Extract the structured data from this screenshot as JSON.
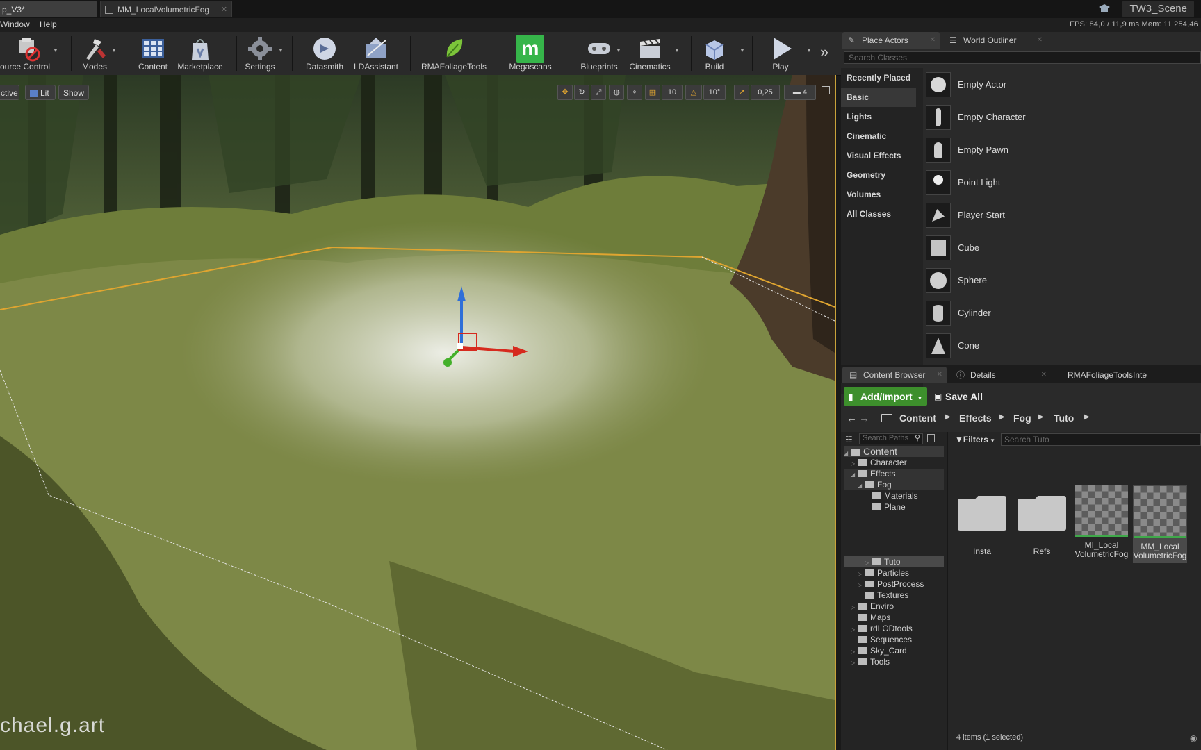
{
  "tabs": [
    {
      "label": "p_V3*",
      "active": true
    },
    {
      "label": "MM_LocalVolumetricFog",
      "active": false
    }
  ],
  "scene_name": "TW3_Scene",
  "menu": [
    "Window",
    "Help"
  ],
  "stats": "FPS: 84,0   / 11,9 ms   Mem: 11 254,46",
  "toolbar": [
    {
      "label": "ource Control",
      "icon": "source-control-icon"
    },
    {
      "label": "Modes",
      "icon": "modes-icon"
    },
    {
      "label": "Content",
      "icon": "content-icon"
    },
    {
      "label": "Marketplace",
      "icon": "marketplace-icon"
    },
    {
      "label": "Settings",
      "icon": "settings-icon"
    },
    {
      "label": "Datasmith",
      "icon": "datasmith-icon"
    },
    {
      "label": "LDAssistant",
      "icon": "ldassistant-icon"
    },
    {
      "label": "RMAFoliageTools",
      "icon": "leaf-icon"
    },
    {
      "label": "Megascans",
      "icon": "megascans-icon"
    },
    {
      "label": "Blueprints",
      "icon": "blueprints-icon"
    },
    {
      "label": "Cinematics",
      "icon": "clapper-icon"
    },
    {
      "label": "Build",
      "icon": "build-icon"
    },
    {
      "label": "Play",
      "icon": "play-icon"
    }
  ],
  "viewport": {
    "mode_left": "ctive",
    "lit": "Lit",
    "show": "Show",
    "grid_snap": "10",
    "rot_snap": "10°",
    "scale_snap": "0,25",
    "cam_speed": "4",
    "watermark": "chael.g.art"
  },
  "place_actors": {
    "tab": "Place Actors",
    "outliner_tab": "World Outliner",
    "search_placeholder": "Search Classes",
    "categories": [
      "Recently Placed",
      "Basic",
      "Lights",
      "Cinematic",
      "Visual Effects",
      "Geometry",
      "Volumes",
      "All Classes"
    ],
    "selected_category": "Basic",
    "actors": [
      "Empty Actor",
      "Empty Character",
      "Empty Pawn",
      "Point Light",
      "Player Start",
      "Cube",
      "Sphere",
      "Cylinder",
      "Cone"
    ]
  },
  "content_browser": {
    "tab": "Content Browser",
    "details_tab": "Details",
    "rma_tab": "RMAFoliageToolsInte",
    "add_import": "Add/Import",
    "save_all": "Save All",
    "breadcrumb": [
      "Content",
      "Effects",
      "Fog",
      "Tuto"
    ],
    "search_paths_placeholder": "Search Paths",
    "filters": "Filters",
    "search_placeholder": "Search Tuto",
    "tree": [
      {
        "label": "Content",
        "indent": 0,
        "arrow": "◢"
      },
      {
        "label": "Character",
        "indent": 1,
        "arrow": "▷"
      },
      {
        "label": "Effects",
        "indent": 1,
        "arrow": "◢"
      },
      {
        "label": "Fog",
        "indent": 2,
        "arrow": "◢"
      },
      {
        "label": "Materials",
        "indent": 3,
        "arrow": ""
      },
      {
        "label": "Plane",
        "indent": 3,
        "arrow": ""
      },
      {
        "label": "Tuto",
        "indent": 3,
        "arrow": "▷"
      },
      {
        "label": "Particles",
        "indent": 2,
        "arrow": "▷"
      },
      {
        "label": "PostProcess",
        "indent": 2,
        "arrow": "▷"
      },
      {
        "label": "Textures",
        "indent": 2,
        "arrow": ""
      },
      {
        "label": "Enviro",
        "indent": 1,
        "arrow": "▷"
      },
      {
        "label": "Maps",
        "indent": 1,
        "arrow": ""
      },
      {
        "label": "rdLODtools",
        "indent": 1,
        "arrow": "▷"
      },
      {
        "label": "Sequences",
        "indent": 1,
        "arrow": ""
      },
      {
        "label": "Sky_Card",
        "indent": 1,
        "arrow": "▷"
      },
      {
        "label": "Tools",
        "indent": 1,
        "arrow": "▷"
      }
    ],
    "assets": [
      {
        "label": "Insta",
        "type": "folder"
      },
      {
        "label": "Refs",
        "type": "folder"
      },
      {
        "label": "MI_Local VolumetricFog",
        "type": "material"
      },
      {
        "label": "MM_Local VolumetricFog",
        "type": "material"
      }
    ],
    "status": "4 items (1 selected)"
  }
}
